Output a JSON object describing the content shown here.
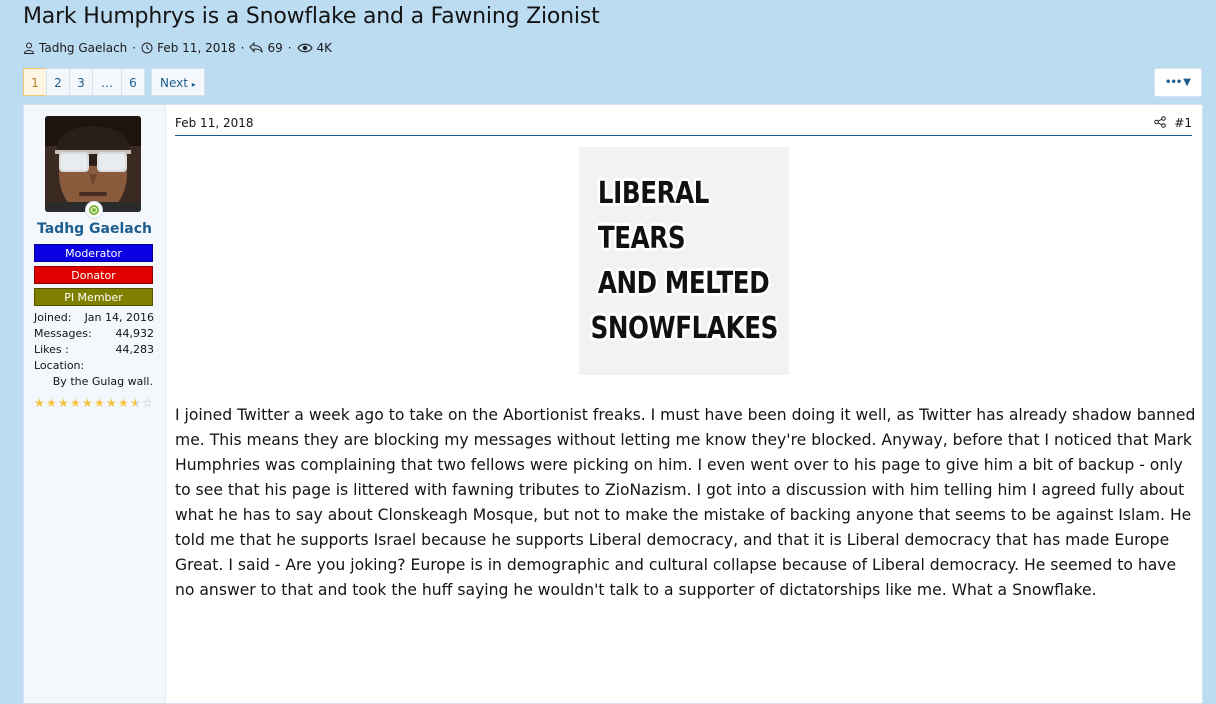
{
  "thread": {
    "title": "Mark Humphrys is a Snowflake and a Fawning Zionist",
    "author": "Tadhg Gaelach",
    "date": "Feb 11, 2018",
    "replies": "69",
    "views": "4K"
  },
  "pagination": {
    "pages": [
      "1",
      "2",
      "3",
      "…",
      "6"
    ],
    "current": "1",
    "next_label": "Next"
  },
  "toolbar": {
    "menu_label": "•••"
  },
  "post": {
    "date": "Feb 11, 2018",
    "number": "#1",
    "image_text": [
      "LIBERAL TEARS",
      "AND MELTED",
      "SNOWFLAKES"
    ],
    "body": "I joined Twitter a week ago to take on the Abortionist freaks. I must have been doing it well, as Twitter has already shadow banned me. This means they are blocking my messages without letting me know they're blocked. Anyway, before that I noticed that Mark Humphries was complaining that two fellows were picking on him. I even went over to his page to give him a bit of backup - only to see that his page is littered with fawning tributes to ZioNazism. I got into a discussion with him telling him I agreed fully about what he has to say about Clonskeagh Mosque, but not to make the mistake of backing anyone that seems to be against Islam. He told me that he supports Israel because he supports Liberal democracy, and that it is Liberal democracy that has made Europe Great. I said - Are you joking? Europe is in demographic and cultural collapse because of Liberal democracy. He seemed to have no answer to that and took the huff saying he wouldn't talk to a supporter of dictatorships like me. What a Snowflake."
  },
  "user": {
    "name": "Tadhg Gaelach",
    "banners": [
      {
        "label": "Moderator",
        "color": "#0b00e4"
      },
      {
        "label": "Donator",
        "color": "#e00000"
      },
      {
        "label": "PI Member",
        "color": "#808000"
      }
    ],
    "stats": {
      "joined_label": "Joined:",
      "joined": "Jan 14, 2016",
      "messages_label": "Messages:",
      "messages": "44,932",
      "likes_label": "Likes :",
      "likes": "44,283",
      "location_label": "Location:",
      "location": "By the Gulag wall."
    },
    "rating_stars": 8.5,
    "rating_max": 10
  },
  "colors": {
    "accent": "#1d5d8f",
    "background": "#bcdcf2",
    "star": "#f4c542",
    "online": "#7cbc3e"
  }
}
